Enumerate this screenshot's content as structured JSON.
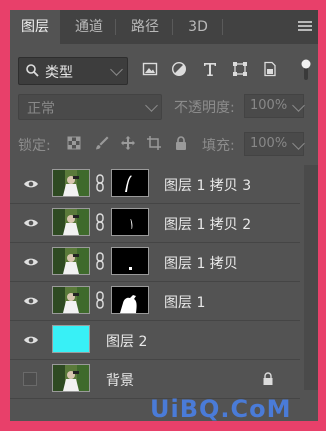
{
  "colors": {
    "frame": "#e8406a",
    "panel": "#535353",
    "tabbar": "#424242",
    "text": "#e8e8e8",
    "cyan": "#38f0f6",
    "watermark": "#4a7bd8"
  },
  "tabs": [
    {
      "label": "图层",
      "active": true
    },
    {
      "label": "通道",
      "active": false
    },
    {
      "label": "路径",
      "active": false
    },
    {
      "label": "3D",
      "active": false
    }
  ],
  "filter": {
    "label": "类型",
    "icons": [
      "image-filter-icon",
      "adjustment-filter-icon",
      "type-filter-icon",
      "shape-filter-icon",
      "smart-object-filter-icon"
    ]
  },
  "blend": {
    "mode": "正常",
    "opacity_label": "不透明度:",
    "opacity_value": "100%"
  },
  "lock": {
    "label": "锁定:",
    "fill_label": "填充:",
    "fill_value": "100%"
  },
  "layers": [
    {
      "name": "图层 1 拷贝 3",
      "visible": true,
      "has_mask": true
    },
    {
      "name": "图层 1 拷贝 2",
      "visible": true,
      "has_mask": true
    },
    {
      "name": "图层 1 拷贝",
      "visible": true,
      "has_mask": true
    },
    {
      "name": "图层 1",
      "visible": true,
      "has_mask": true
    },
    {
      "name": "图层 2",
      "visible": true,
      "has_mask": false
    },
    {
      "name": "背景",
      "visible": false,
      "has_mask": false,
      "locked": true
    }
  ],
  "watermark": "UiBQ.CoM"
}
